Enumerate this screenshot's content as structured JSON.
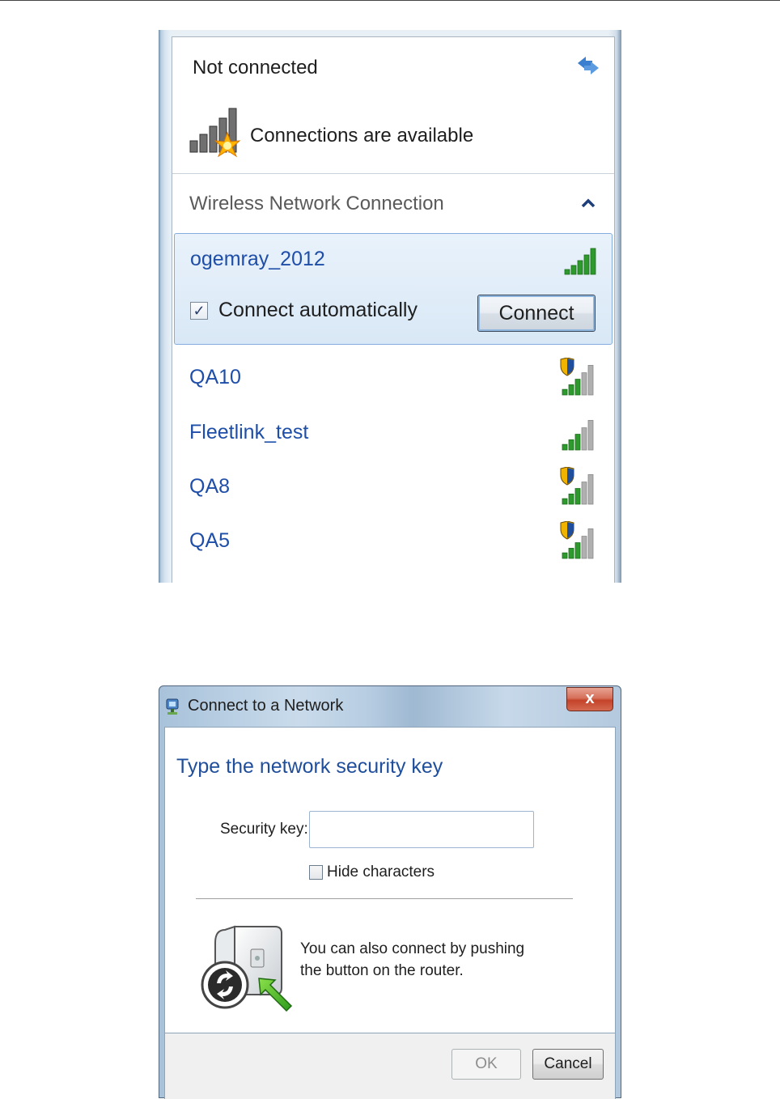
{
  "flyout": {
    "status": "Not connected",
    "availability": "Connections are available",
    "section_title": "Wireless Network Connection",
    "selected_network": {
      "ssid": "ogemray_2012",
      "connect_automatically_label": "Connect automatically",
      "connect_automatically_checked": true,
      "connect_button": "Connect",
      "signal_bars": 5,
      "secured": false
    },
    "networks": [
      {
        "ssid": "QA10",
        "signal_bars": 3,
        "secured": true
      },
      {
        "ssid": "Fleetlink_test",
        "signal_bars": 3,
        "secured": false
      },
      {
        "ssid": "QA8",
        "signal_bars": 3,
        "secured": true
      },
      {
        "ssid": "QA5",
        "signal_bars": 3,
        "secured": true
      }
    ]
  },
  "dialog": {
    "title": "Connect to a Network",
    "close_label": "x",
    "heading": "Type the network security key",
    "security_key_label": "Security key:",
    "security_key_value": "",
    "hide_characters_label": "Hide characters",
    "hide_characters_checked": false,
    "wps_text": "You can also connect by pushing the button on the router.",
    "ok_button": "OK",
    "ok_enabled": false,
    "cancel_button": "Cancel"
  },
  "colors": {
    "link_blue": "#1e4ea8",
    "heading_blue": "#1f4e9c",
    "signal_green": "#2e9a2e",
    "signal_gray": "#b0b0b0",
    "selection_border": "#84acdd"
  }
}
